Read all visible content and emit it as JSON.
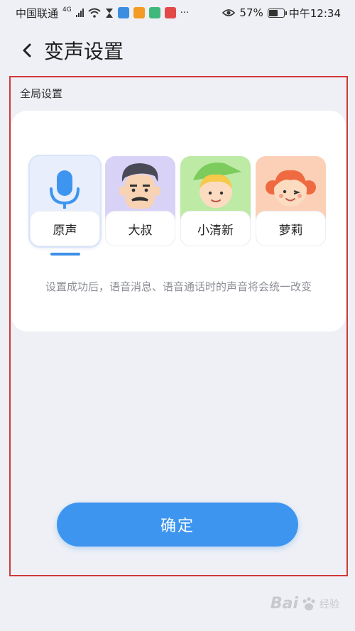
{
  "status_bar": {
    "carrier": "中国联通",
    "network": "4G",
    "battery": "57%",
    "time": "中午12:34"
  },
  "header": {
    "title": "变声设置"
  },
  "section": {
    "label": "全局设置"
  },
  "voices": [
    {
      "label": "原声",
      "selected": true,
      "bg": "#e8eefb"
    },
    {
      "label": "大叔",
      "selected": false,
      "bg": "#d9d2f7"
    },
    {
      "label": "小清新",
      "selected": false,
      "bg": "#bdeaa5"
    },
    {
      "label": "萝莉",
      "selected": false,
      "bg": "#fcd0b7"
    }
  ],
  "hint": "设置成功后，语音消息、语音通话时的声音将会统一改变",
  "confirm_label": "确定",
  "watermark": {
    "brand": "Bai",
    "sub": "经验"
  },
  "colors": {
    "accent": "#3d95ef",
    "highlight_frame": "#d23838",
    "background": "#eef0f5"
  }
}
